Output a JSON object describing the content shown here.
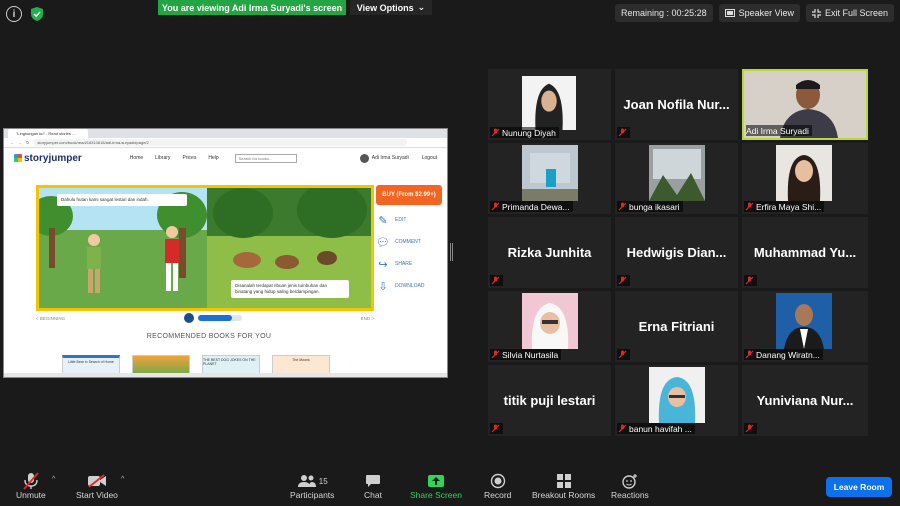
{
  "banner": {
    "viewing_text": "You are viewing Adi Irma Suryadi's screen",
    "view_options": "View Options"
  },
  "top_right": {
    "remaining": "Remaining : 00:25:28",
    "speaker_view": "Speaker View",
    "exit_full_screen": "Exit Full Screen"
  },
  "shared_screen": {
    "tab_title": "\"Lingkungan ku\" - Read stories ...",
    "url": "storyjumper.com/book/read/16310815/adi-irma-suryadi#page/2",
    "logo": "storyjumper",
    "nav": [
      "Home",
      "Library",
      "Prices",
      "Help"
    ],
    "search_placeholder": "Search for books...",
    "user_name": "Adi Irma Suryadi",
    "logout": "Logout",
    "caption_left": "Dahulu hutan kami sangat lestari dan indah.",
    "caption_right": "Disanalah terdapat ribuan jenis tumbuhan dan binatang yang hidup saling berdampingan.",
    "buy_label": "BUY (From $2.99+)",
    "actions": [
      {
        "label": "EDIT",
        "icon": "pencil-icon"
      },
      {
        "label": "COMMENT",
        "icon": "comment-icon"
      },
      {
        "label": "SHARE",
        "icon": "share-icon"
      },
      {
        "label": "DOWNLOAD",
        "icon": "download-icon"
      }
    ],
    "beginning": "< BEGINNING",
    "end": "END >",
    "recommended_title": "RECOMMENDED BOOKS FOR YOU",
    "recommended": [
      "Little Bear in Search of Home",
      "",
      "THE BEST DOG JOKES ON THE PLANET",
      "The Moons"
    ]
  },
  "participants_tiles": [
    {
      "name": "Nunung Diyah",
      "type": "video"
    },
    {
      "name": "Joan Nofila Nur...",
      "type": "name"
    },
    {
      "name": "Adi Irma Suryadi",
      "type": "video",
      "active": true
    },
    {
      "name": "Primanda Dewa...",
      "type": "video"
    },
    {
      "name": "bunga ikasari",
      "type": "video"
    },
    {
      "name": "Erfira Maya Shi...",
      "type": "video"
    },
    {
      "name": "Rizka Junhita",
      "type": "name"
    },
    {
      "name": "Hedwigis Dian...",
      "type": "name"
    },
    {
      "name": "Muhammad Yu...",
      "type": "name"
    },
    {
      "name": "Silvia Nurtasila",
      "type": "video"
    },
    {
      "name": "Erna Fitriani",
      "type": "name"
    },
    {
      "name": "Danang Wiratn...",
      "type": "video"
    },
    {
      "name": "titik puji lestari",
      "type": "name"
    },
    {
      "name": "banun havifah ...",
      "type": "video"
    },
    {
      "name": "Yuniviana Nur...",
      "type": "name"
    }
  ],
  "toolbar": {
    "unmute": "Unmute",
    "start_video": "Start Video",
    "participants": "Participants",
    "participants_count": "15",
    "chat": "Chat",
    "share_screen": "Share Screen",
    "record": "Record",
    "breakout_rooms": "Breakout Rooms",
    "reactions": "Reactions",
    "leave_room": "Leave Room"
  },
  "colors": {
    "accent_green": "#22a542",
    "active_border": "#b9d93b",
    "leave_blue": "#0e71eb",
    "mic_off_red": "#e02828"
  }
}
